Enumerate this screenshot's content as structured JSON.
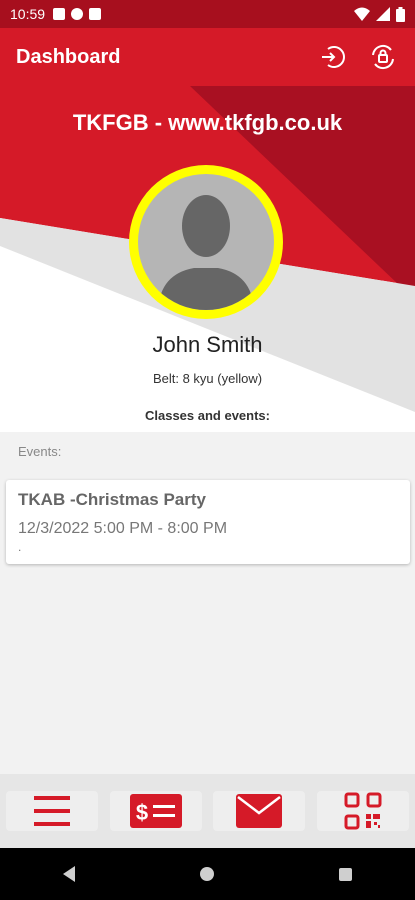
{
  "statusbar": {
    "time": "10:59"
  },
  "appbar": {
    "title": "Dashboard",
    "icons": [
      "logout-icon",
      "lock-rotate-icon"
    ]
  },
  "profile": {
    "site": "TKFGB - www.tkfgb.co.uk",
    "name": "John Smith",
    "belt": "Belt:  8 kyu (yellow)",
    "classes_label": "Classes and events:",
    "avatar_ring_color": "#ffff00"
  },
  "events": {
    "label": "Events:",
    "items": [
      {
        "title": "TKAB -Christmas Party",
        "time": "12/3/2022 5:00 PM - 8:00 PM",
        "note": "."
      }
    ]
  },
  "tabbar": {
    "icons": [
      "menu-icon",
      "payment-icon",
      "mail-icon",
      "qr-code-icon"
    ]
  },
  "colors": {
    "brand": "#d51a28",
    "status": "#a70f1e"
  }
}
